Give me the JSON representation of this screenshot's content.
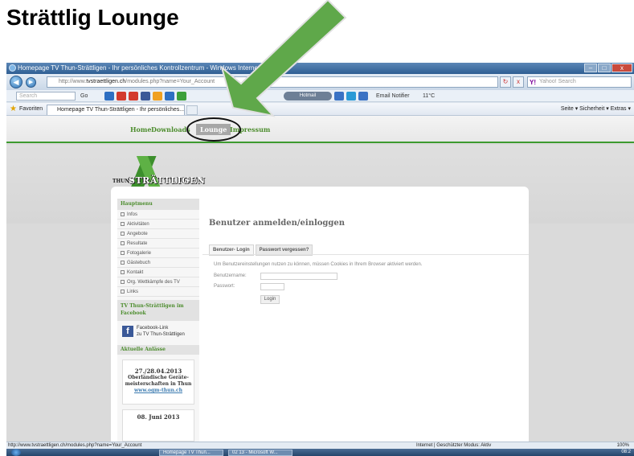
{
  "doc_title": "Strättlig Lounge",
  "window": {
    "title": "Homepage TV Thun-Strättligen - Ihr persönliches Kontrollzentrum - Windows Internet Explo",
    "controls": [
      "–",
      "□",
      "x"
    ]
  },
  "address": {
    "prefix": "http://www.",
    "domain": "tvstraettligen.ch",
    "path": "/modules.php?name=Your_Account",
    "refresh": "↻",
    "stop": "x"
  },
  "search": {
    "yahoo_logo": "Y!",
    "placeholder": "Yahoo! Search"
  },
  "toolbar": {
    "search_placeholder": "Search",
    "go_label": "Go",
    "pill_label": "Hotmail",
    "email_notifier": "Email Notifier",
    "temperature": "11°C"
  },
  "favorites": {
    "label": "Favoriten",
    "tab_title": "Homepage TV Thun-Strättligen - Ihr persönliches...",
    "right_tools": "Seite ▾   Sicherheit ▾   Extras ▾"
  },
  "nav": {
    "items": [
      "Home",
      "Downloads",
      "Lounge",
      "Impressum"
    ],
    "active": "Lounge"
  },
  "logo": {
    "thun": "THUN",
    "straettligen": "STRÄTTLIGEN"
  },
  "sidebar": {
    "main_menu_title": "Hauptmenu",
    "menu": [
      "Infos",
      "Aktivitäten",
      "Angebote",
      "Resultate",
      "Fotogalerie",
      "Gästebuch",
      "Kontakt",
      "Org. Wettkämpfe des TV",
      "Links"
    ],
    "facebook_title": "TV Thun-Strättligen im Facebook",
    "facebook_link_line1": "Facebook-Link",
    "facebook_link_line2": "zu TV Thun-Strättligen",
    "events_title": "Aktuelle Anlässe",
    "event1_date": "27./28.04.2013",
    "event1_line1": "Oberländische Geräte-",
    "event1_line2": "meisterschaften in Thun",
    "event1_link": "www.ogm-thun.ch",
    "event2_date": "08. Juni 2013"
  },
  "login": {
    "title": "Benutzer anmelden/einloggen",
    "tab_login": "Benutzer- Login",
    "tab_forgot": "Passwort vergessen?",
    "cookie_note": "Um Benutzereinstellungen nutzen zu können, müssen Cookies in Ihrem Browser aktiviert werden.",
    "username_label": "Benutzername:",
    "password_label": "Passwort:",
    "login_button": "Login"
  },
  "status": {
    "url": "http://www.tvstraettligen.ch/modules.php?name=Your_Account",
    "zone": "Internet | Geschützter Modus: Aktiv",
    "zoom": "100%"
  },
  "taskbar": {
    "tasks": [
      "Homepage TV Thun...",
      "02 13 - Microsoft W..."
    ],
    "clock": "08:2"
  },
  "colors": {
    "accent_green": "#3d9a2f",
    "arrow_green": "#5fa84a",
    "nav_active_bg": "#a7a7a7"
  }
}
